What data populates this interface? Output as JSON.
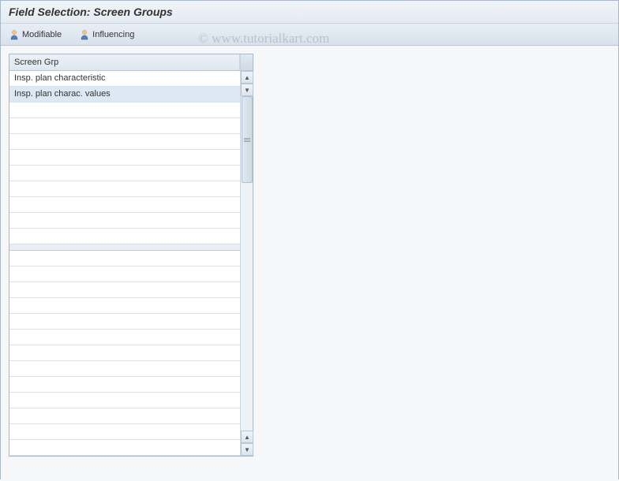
{
  "title": "Field Selection: Screen Groups",
  "toolbar": {
    "modifiable_label": "Modifiable",
    "influencing_label": "Influencing"
  },
  "watermark": "© www.tutorialkart.com",
  "table": {
    "header": "Screen Grp",
    "rows": [
      "Insp. plan characteristic",
      "Insp. plan charac. values"
    ]
  }
}
